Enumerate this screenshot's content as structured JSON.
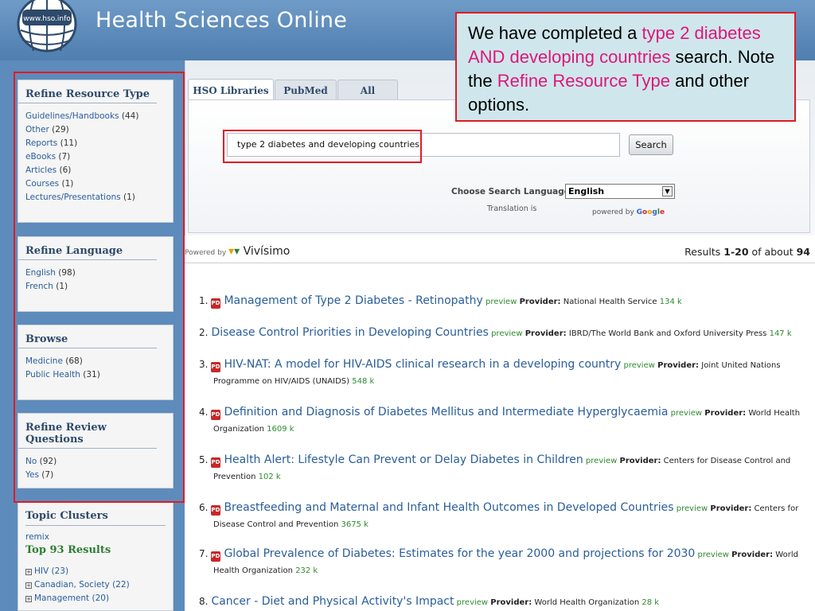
{
  "header": {
    "logo_text": "www.hso.info",
    "brand": "Health Sciences Online"
  },
  "callout": {
    "part1": "We have completed a ",
    "hl1": "type 2 diabetes AND developing countries",
    "part2": " search. Note the ",
    "hl2": "Refine Resource Type",
    "part3": " and other options."
  },
  "sidebar": {
    "resource_type": {
      "title": "Refine Resource Type",
      "items": [
        {
          "label": "Guidelines/Handbooks",
          "count": "(44)"
        },
        {
          "label": "Other",
          "count": "(29)"
        },
        {
          "label": "Reports",
          "count": "(11)"
        },
        {
          "label": "eBooks",
          "count": "(7)"
        },
        {
          "label": "Articles",
          "count": "(6)"
        },
        {
          "label": "Courses",
          "count": "(1)"
        },
        {
          "label": "Lectures/Presentations",
          "count": "(1)"
        }
      ]
    },
    "language": {
      "title": "Refine Language",
      "items": [
        {
          "label": "English",
          "count": "(98)"
        },
        {
          "label": "French",
          "count": "(1)"
        }
      ]
    },
    "browse": {
      "title": "Browse",
      "items": [
        {
          "label": "Medicine",
          "count": "(68)"
        },
        {
          "label": "Public Health",
          "count": "(31)"
        }
      ]
    },
    "review": {
      "title": "Refine Review Questions",
      "items": [
        {
          "label": "No",
          "count": "(92)"
        },
        {
          "label": "Yes",
          "count": "(7)"
        }
      ]
    },
    "clusters": {
      "title": "Topic Clusters",
      "remix": "remix",
      "top": "Top 93 Results",
      "items": [
        {
          "label": "HIV",
          "count": "(23)"
        },
        {
          "label": "Canadian, Society",
          "count": "(22)"
        },
        {
          "label": "Management",
          "count": "(20)"
        }
      ]
    }
  },
  "tabs": [
    "HSO Libraries",
    "PubMed",
    "All"
  ],
  "search": {
    "value": "type 2 diabetes and developing countries",
    "button": "Search",
    "lang_label": "Choose Search Language:",
    "lang_value": "English",
    "translation": "Translation is",
    "powered_by": "powered by",
    "google": [
      "G",
      "o",
      "o",
      "g",
      "l",
      "e"
    ]
  },
  "vivisimo": {
    "powered_by": "Powered by",
    "name": "Vivísimo"
  },
  "results_count": {
    "prefix": "Results ",
    "range": "1-20",
    "middle": " of about ",
    "total": "94"
  },
  "results": [
    {
      "num": "1.",
      "pdf": true,
      "title": "Management of Type 2 Diabetes - Retinopathy",
      "preview": "preview",
      "provider": "National Health Service",
      "size": "134 k",
      "provider_2": ""
    },
    {
      "num": "2.",
      "pdf": false,
      "title": "Disease Control Priorities in Developing Countries",
      "preview": "preview",
      "provider": "IBRD/The World Bank and Oxford University Press",
      "size": "147 k",
      "provider_2": ""
    },
    {
      "num": "3.",
      "pdf": true,
      "title": "HIV-NAT: A model for HIV-AIDS clinical research in a developing country",
      "preview": "preview",
      "provider": "Joint United Nations",
      "provider_2": "Programme on HIV/AIDS (UNAIDS)",
      "size": "548 k"
    },
    {
      "num": "4.",
      "pdf": true,
      "title": "Definition and Diagnosis of Diabetes Mellitus and Intermediate Hyperglycaemia",
      "preview": "preview",
      "provider": "World Health",
      "provider_2": "Organization",
      "size": "1609 k"
    },
    {
      "num": "5.",
      "pdf": true,
      "title": "Health Alert: Lifestyle Can Prevent or Delay Diabetes in Children",
      "preview": "preview",
      "provider": "Centers for Disease Control and",
      "provider_2": "Prevention",
      "size": "102 k"
    },
    {
      "num": "6.",
      "pdf": true,
      "title": "Breastfeeding and Maternal and Infant Health Outcomes in Developed Countries",
      "preview": "preview",
      "provider": "Centers for",
      "provider_2": "Disease Control and Prevention",
      "size": "3675 k"
    },
    {
      "num": "7.",
      "pdf": true,
      "title": "Global Prevalence of Diabetes: Estimates for the year 2000 and projections for 2030",
      "preview": "preview",
      "provider": "World",
      "provider_2": "Health Organization",
      "size": "232 k"
    },
    {
      "num": "8.",
      "pdf": false,
      "title": "Cancer - Diet and Physical Activity's Impact",
      "preview": "preview",
      "provider": "World Health Organization",
      "size": "28 k",
      "provider_2": ""
    }
  ],
  "labels": {
    "provider": "Provider:"
  },
  "colors": {
    "header_blue": "#5b89b8",
    "red_box": "#e01b24",
    "link_blue": "#2a5d9a",
    "green": "#2e8b2e",
    "highlight_pink": "#e0157a",
    "callout_bg": "#cfe7ec"
  }
}
